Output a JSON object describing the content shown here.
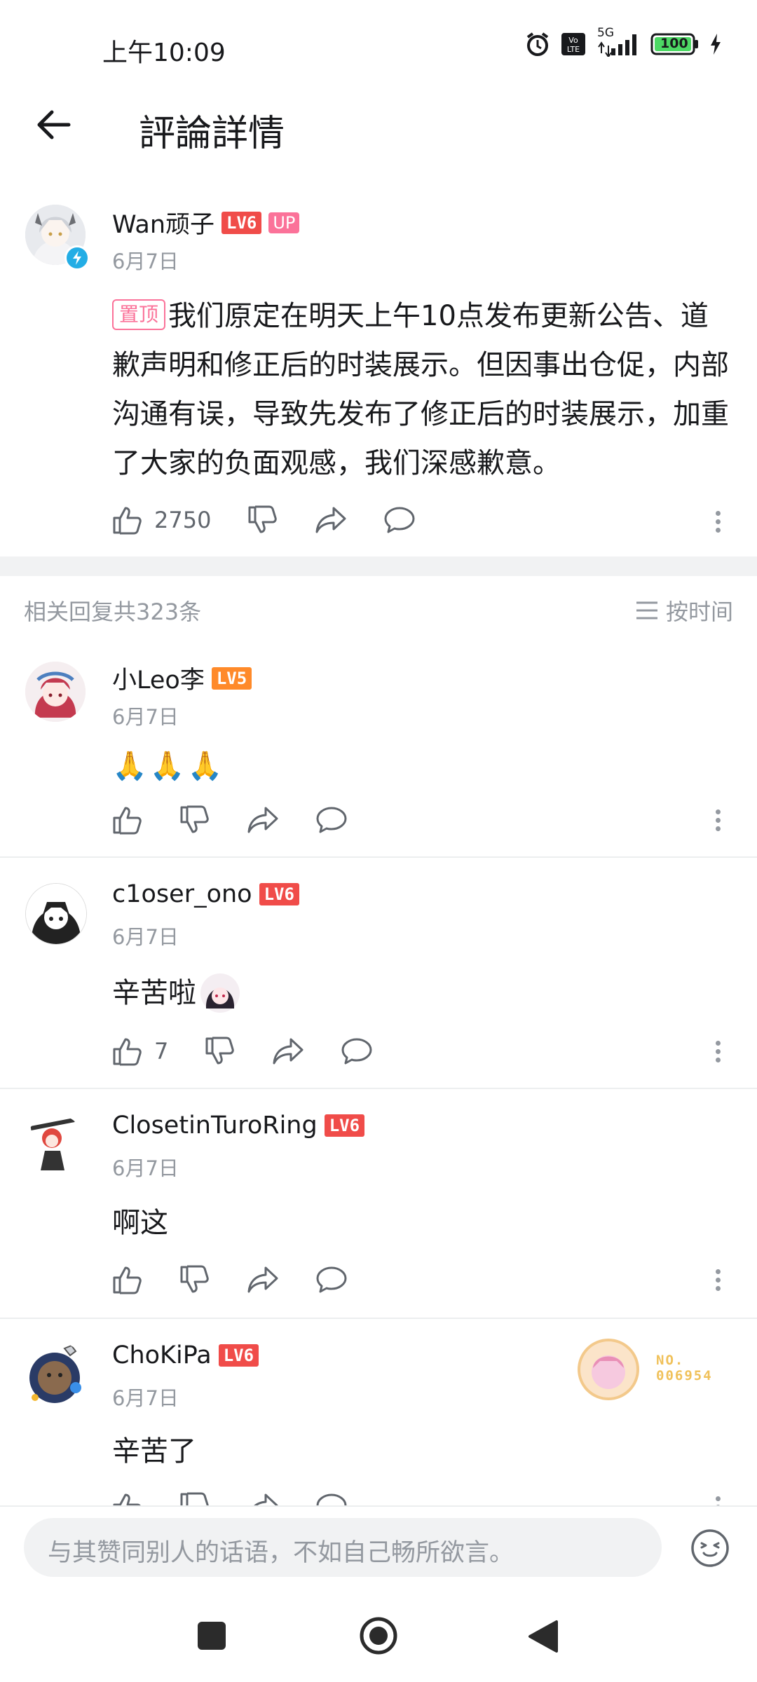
{
  "status_bar": {
    "time": "上午10:09",
    "network": "5G",
    "battery": "100"
  },
  "app_bar": {
    "back_icon": "arrow-left-icon",
    "title": "評論詳情"
  },
  "main_comment": {
    "username": "Wan顽子",
    "level": "LV6",
    "badge": "UP",
    "date": "6月7日",
    "pin_label": "置顶",
    "text": "我们原定在明天上午10点发布更新公告、道歉声明和修正后的时装展示。但因事出仓促，内部沟通有误，导致先发布了修正后的时装展示，加重了大家的负面观感，我们深感歉意。",
    "likes": "2750"
  },
  "replies_header": {
    "count_label": "相关回复共323条",
    "sort_label": "按时间"
  },
  "replies": [
    {
      "username": "小Leo李",
      "level": "LV5",
      "date": "6月7日",
      "text": "🙏🙏🙏",
      "likes": ""
    },
    {
      "username": "c1oser_ono",
      "level": "LV6",
      "date": "6月7日",
      "text": "辛苦啦",
      "likes": "7"
    },
    {
      "username": "ClosetinTuroRing",
      "level": "LV6",
      "date": "6月7日",
      "text": "啊这",
      "likes": ""
    },
    {
      "username": "ChoKiPa",
      "level": "LV6",
      "date": "6月7日",
      "text": "辛苦了",
      "likes": "",
      "card_no": "NO.\n006954"
    }
  ],
  "composer": {
    "placeholder": "与其赞同别人的话语，不如自己畅所欲言。"
  },
  "colors": {
    "pink": "#fb7299",
    "lv6": "#f04c49",
    "lv5": "#ff8a2a",
    "gray_text": "#9499a0"
  }
}
